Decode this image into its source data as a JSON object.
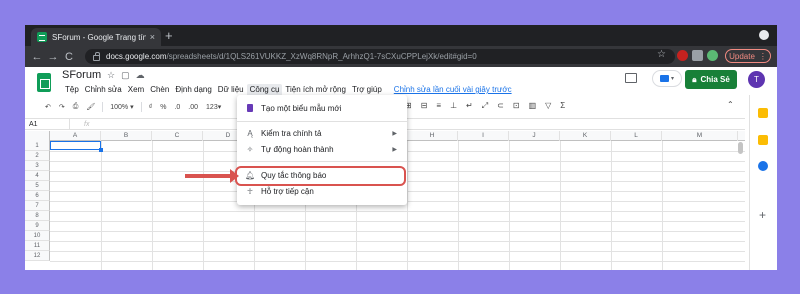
{
  "browser": {
    "tab_title": "SForum - Google Trang tính",
    "tab_close": "×",
    "new_tab": "+",
    "url_host": "docs.google.com",
    "url_path": "/spreadsheets/d/1QLS261VUKKZ_XzWq8RNpR_ArhhzQ1-7sCXuCPPLejXk/edit#gid=0",
    "update_label": "Update",
    "nav_back": "←",
    "nav_forward": "→",
    "nav_reload": "C"
  },
  "sheet": {
    "title": "SForum",
    "share_label": "Chia Sẻ",
    "avatar_letter": "T",
    "last_edit": "Chỉnh sửa lần cuối vài giây trước",
    "menu": [
      "Tệp",
      "Chỉnh sửa",
      "Xem",
      "Chèn",
      "Định dạng",
      "Dữ liệu",
      "Công cụ",
      "Tiện ích mở rộng",
      "Trợ giúp"
    ],
    "active_menu": "Công cụ"
  },
  "toolbar": {
    "zoom": "100%",
    "currency": "₫",
    "percent": "%",
    "decimal_dec": ".0",
    "decimal_inc": ".00",
    "format_more": "123▾"
  },
  "formula": {
    "cell_ref": "A1",
    "fx": "fx"
  },
  "columns": [
    "A",
    "B",
    "C",
    "D",
    "E",
    "F",
    "G",
    "H",
    "I",
    "J",
    "K",
    "L",
    "M"
  ],
  "rows": [
    "1",
    "2",
    "3",
    "4",
    "5",
    "6",
    "7",
    "8",
    "9",
    "10",
    "11",
    "12"
  ],
  "tools_menu": {
    "items": [
      {
        "label": "Tạo một biểu mẫu mới",
        "icon": "form-icon",
        "submenu": false
      },
      {
        "label": "Kiểm tra chính tả",
        "icon": "spellcheck-icon",
        "submenu": true
      },
      {
        "label": "Tự động hoàn thành",
        "icon": "autocomplete-icon",
        "submenu": true
      },
      {
        "label": "Quy tắc thông báo",
        "icon": "bell-icon",
        "submenu": false
      },
      {
        "label": "Hỗ trợ tiếp cận",
        "icon": "accessibility-icon",
        "submenu": false
      }
    ]
  },
  "colors": {
    "background": "#8b80e8",
    "share_green": "#188038",
    "highlight_red": "#d9534f",
    "selection_blue": "#1a73e8"
  }
}
